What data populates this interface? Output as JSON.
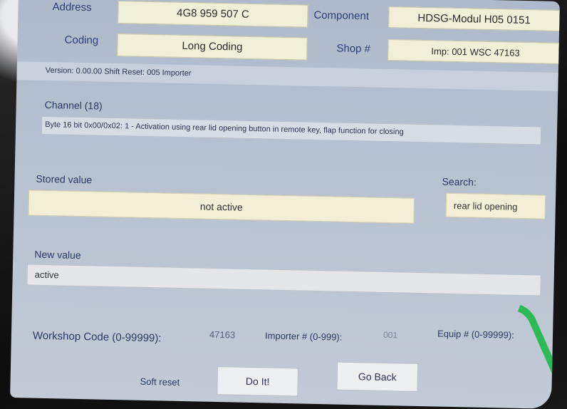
{
  "header": {
    "address_label": "Address",
    "part_number": "4G8 959 507 C",
    "component_label": "Component",
    "component_value": "HDSG-Modul   H05 0151",
    "coding_label": "Coding",
    "coding_value": "Long Coding",
    "shop_label": "Shop #",
    "shop_value": "Imp: 001    WSC 47163"
  },
  "info_line": "Version: 0.00.00 Shift Reset: 005 Importer",
  "channel": {
    "label": "Channel (18)",
    "description": "Byte 16 bit 0x00/0x02: 1 - Activation using rear lid opening button in remote key, flap function for closing"
  },
  "stored": {
    "label": "Stored value",
    "value": "not active"
  },
  "search": {
    "label": "Search:",
    "value": "rear lid opening"
  },
  "new_value": {
    "label": "New value",
    "value": "active"
  },
  "footer": {
    "wsc_label": "Workshop Code (0-99999):",
    "wsc_value": "47163",
    "importer_label": "Importer # (0-999):",
    "importer_value": "001",
    "equip_label": "Equip # (0-99999):"
  },
  "buttons": {
    "soft_reset": "Soft reset",
    "do_it": "Do It!",
    "go_back": "Go Back"
  }
}
